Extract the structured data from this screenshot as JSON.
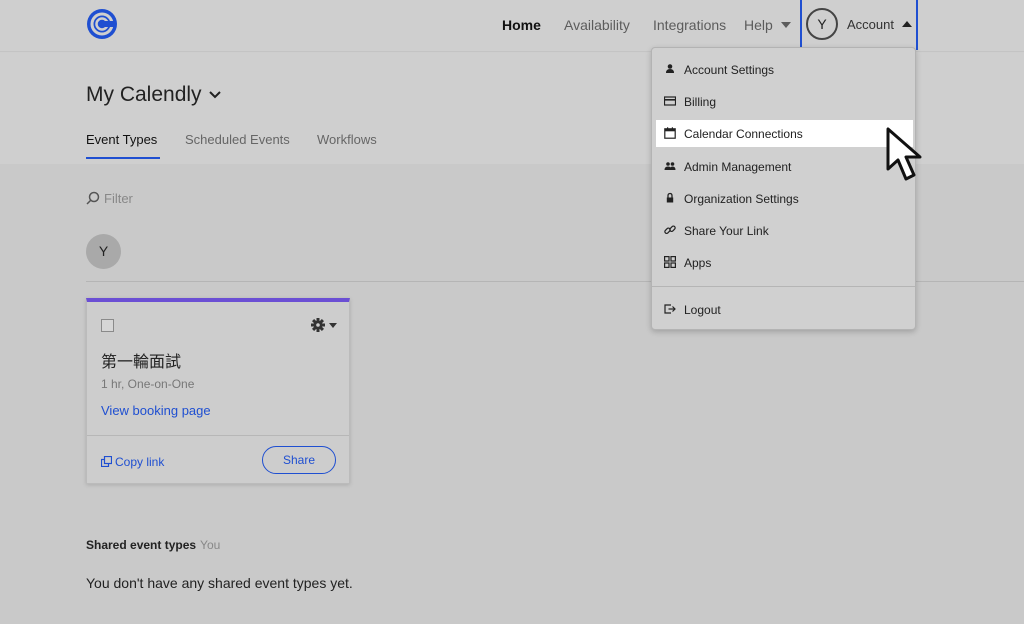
{
  "nav": {
    "home": "Home",
    "availability": "Availability",
    "integrations": "Integrations",
    "help": "Help",
    "account_initial": "Y",
    "account": "Account"
  },
  "header": {
    "title": "My Calendly",
    "tabs": [
      "Event Types",
      "Scheduled Events",
      "Workflows"
    ]
  },
  "main": {
    "filter_placeholder": "Filter",
    "user_initial": "Y"
  },
  "event_card": {
    "title": "第一輪面試",
    "subtitle": "1 hr, One-on-One",
    "view_link": "View booking page",
    "copy_link": "Copy link",
    "share": "Share",
    "accent_color": "#6b4fd4"
  },
  "shared": {
    "heading": "Shared event types",
    "owner": "You",
    "empty_text": "You don't have any shared event types yet."
  },
  "account_menu": {
    "items": [
      {
        "label": "Account Settings",
        "icon": "person-icon"
      },
      {
        "label": "Billing",
        "icon": "credit-card-icon"
      },
      {
        "label": "Calendar Connections",
        "icon": "calendar-icon"
      },
      {
        "label": "Admin Management",
        "icon": "people-icon"
      },
      {
        "label": "Organization Settings",
        "icon": "lock-icon"
      },
      {
        "label": "Share Your Link",
        "icon": "link-icon"
      },
      {
        "label": "Apps",
        "icon": "grid-icon"
      }
    ],
    "logout": "Logout",
    "highlighted": "Calendar Connections"
  },
  "colors": {
    "brand_blue": "#1f4fd1",
    "background": "#cfcfcf"
  }
}
